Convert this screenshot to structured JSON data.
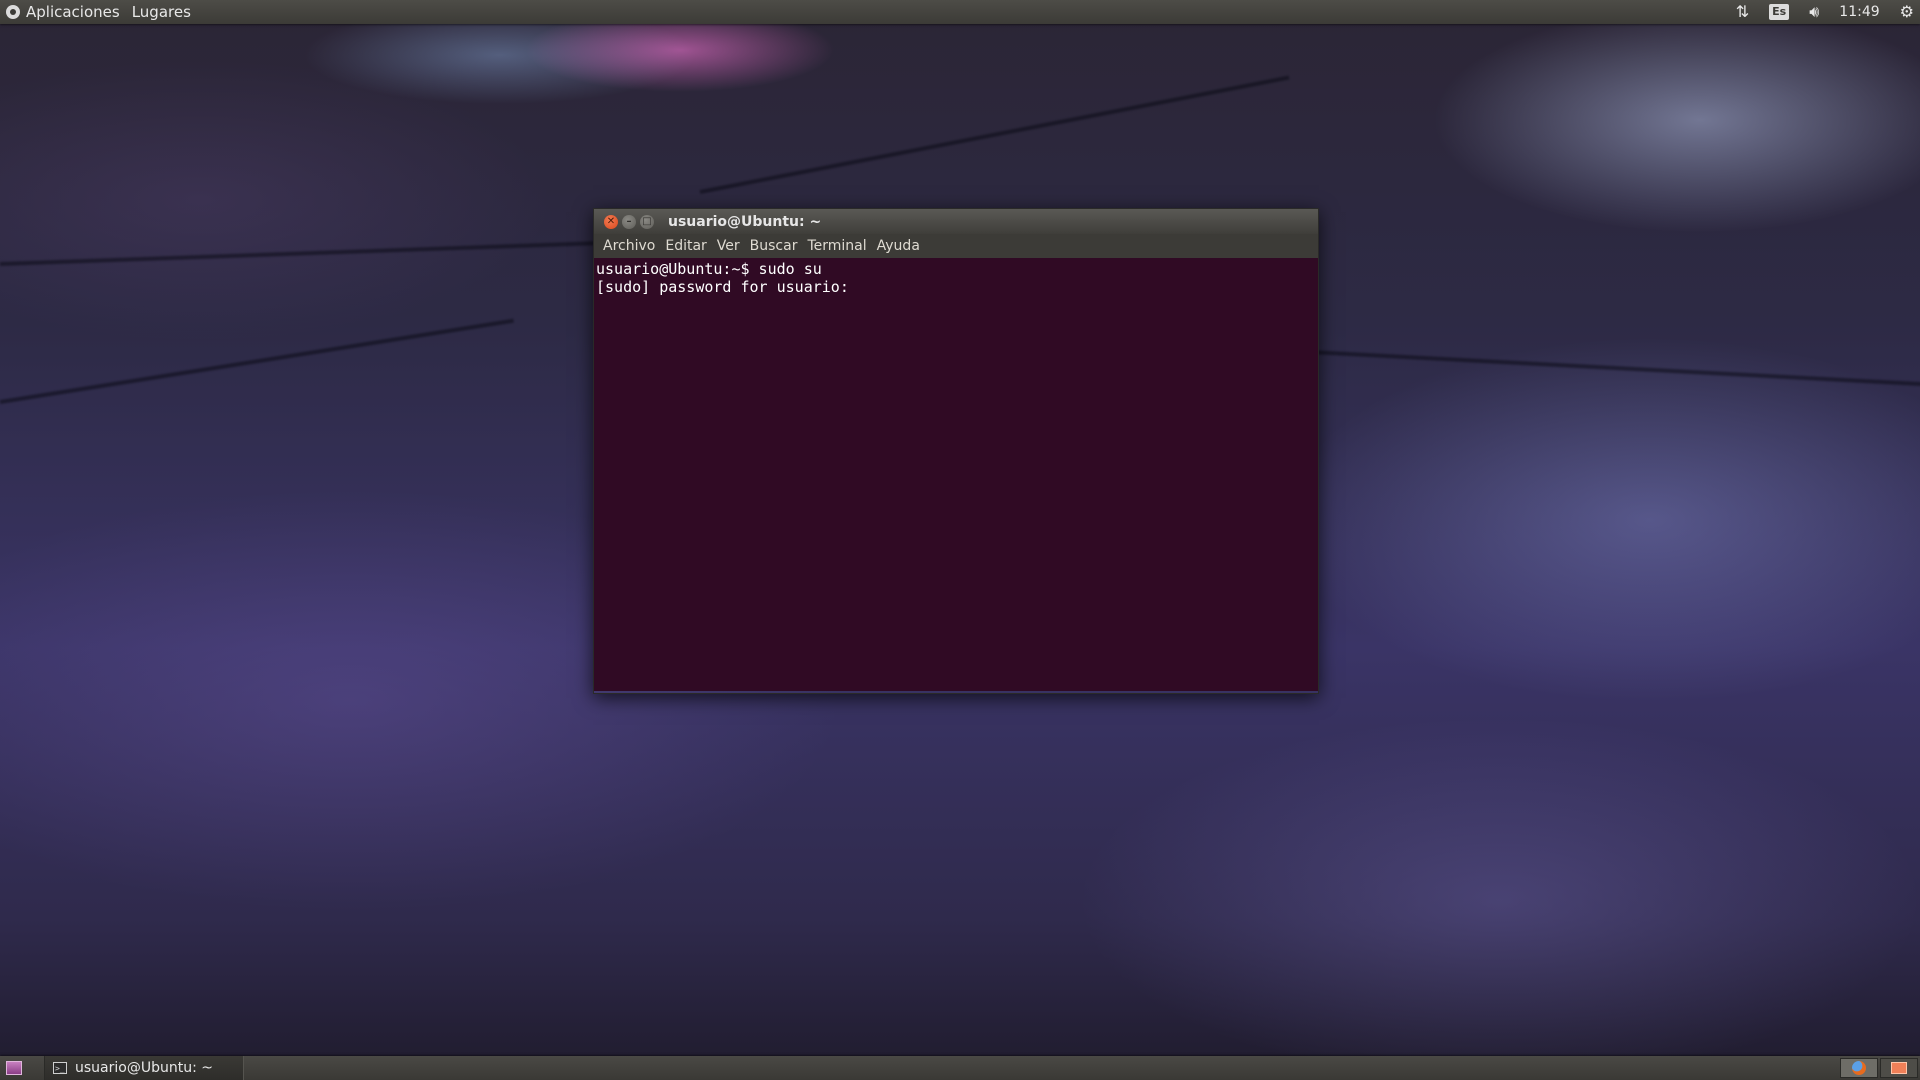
{
  "top_panel": {
    "applications_label": "Aplicaciones",
    "places_label": "Lugares",
    "network_icon": "network-arrows-icon",
    "keyboard_layout": "Es",
    "volume_icon": "volume-icon",
    "clock": "11:49",
    "settings_icon": "gear-icon"
  },
  "terminal": {
    "title": "usuario@Ubuntu: ~",
    "menu": [
      "Archivo",
      "Editar",
      "Ver",
      "Buscar",
      "Terminal",
      "Ayuda"
    ],
    "lines": [
      "usuario@Ubuntu:~$ sudo su",
      "[sudo] password for usuario:"
    ],
    "colors": {
      "background": "#300a24",
      "text": "#ffffff"
    }
  },
  "bottom_panel": {
    "task_label": "usuario@Ubuntu: ~",
    "workspaces": [
      {
        "icon": "firefox-icon",
        "active": true
      },
      {
        "icon": "window-icon",
        "active": false
      }
    ]
  }
}
